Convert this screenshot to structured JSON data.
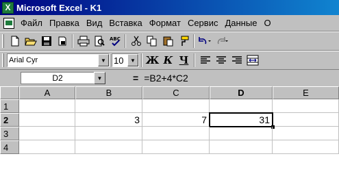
{
  "window": {
    "title": "Microsoft Excel - K1"
  },
  "menu": [
    "Файл",
    "Правка",
    "Вид",
    "Вставка",
    "Формат",
    "Сервис",
    "Данные",
    "О"
  ],
  "format": {
    "font": "Arial Cyr",
    "size": "10"
  },
  "formula_bar": {
    "name_box": "D2",
    "equals": "=",
    "formula": "=B2+4*C2"
  },
  "columns": [
    "A",
    "B",
    "C",
    "D",
    "E"
  ],
  "rows": [
    "1",
    "2",
    "3",
    "4"
  ],
  "cells": {
    "B2": "3",
    "C2": "7",
    "D2": "31"
  }
}
